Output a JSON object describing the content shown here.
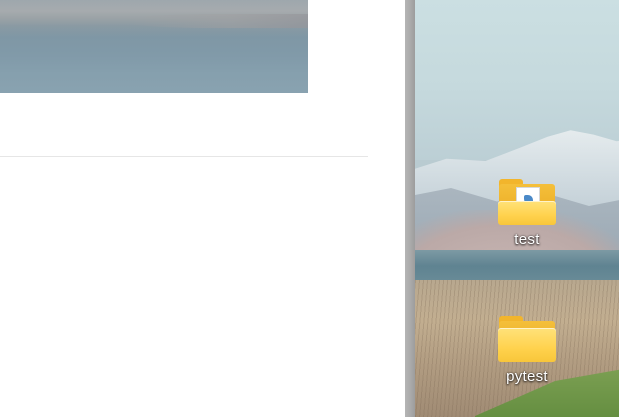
{
  "desktop": {
    "icons": [
      {
        "label": "test",
        "icon": "folder-with-python-file-icon"
      },
      {
        "label": "pytest",
        "icon": "folder-icon"
      }
    ]
  },
  "colors": {
    "folder_yellow": "#ffd24d",
    "window_edge": "#a9a9a9"
  }
}
